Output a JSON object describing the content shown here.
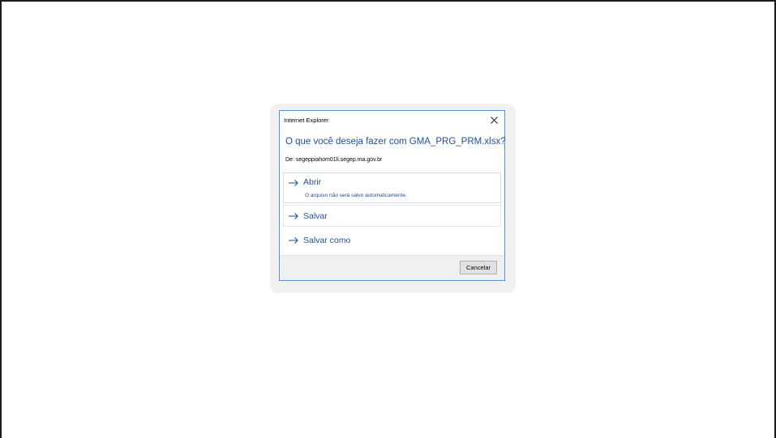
{
  "dialog": {
    "title": "Internet Explorer",
    "question": "O que você deseja fazer com GMA_PRG_PRM.xlsx?",
    "source": "De: segeppiahom01li.segep.ma.gov.br",
    "options": [
      {
        "label": "Abrir",
        "description": "O arquivo não será salvo automaticamente.",
        "icon": "arrow-right-icon"
      },
      {
        "label": "Salvar",
        "icon": "arrow-right-icon"
      },
      {
        "label": "Salvar como",
        "icon": "arrow-right-icon"
      }
    ],
    "cancel_label": "Cancelar",
    "close_icon": "close-icon"
  },
  "colors": {
    "link_blue": "#1f4f9a",
    "dialog_border": "#5a8fd0",
    "footer_bg": "#f0f0f0"
  }
}
